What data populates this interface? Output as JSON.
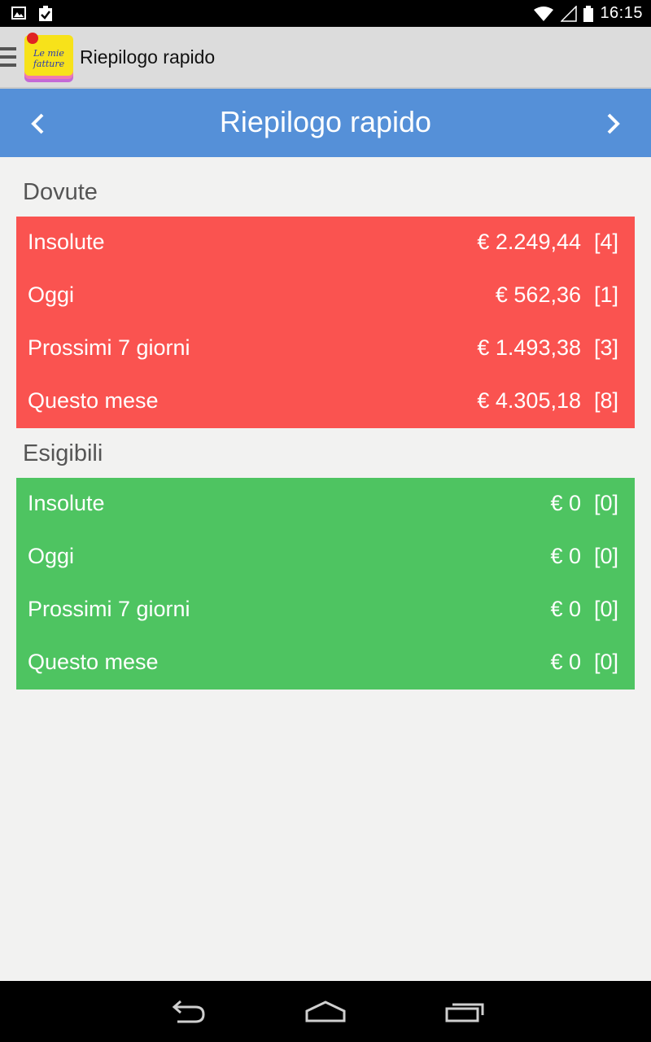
{
  "status_bar": {
    "time": "16:15",
    "icons": [
      "gallery-icon",
      "clipboard-check-icon",
      "wifi-icon",
      "signal-icon",
      "battery-icon"
    ]
  },
  "action_bar": {
    "app_logo_text": "Le mie fatture",
    "title": "Riepilogo rapido"
  },
  "header": {
    "title": "Riepilogo rapido",
    "prev_icon": "chevron-left-icon",
    "next_icon": "chevron-right-icon"
  },
  "sections": [
    {
      "title": "Dovute",
      "color": "#fa5350",
      "rows": [
        {
          "label": "Insolute",
          "amount": "€ 2.249,44",
          "count": "[4]"
        },
        {
          "label": "Oggi",
          "amount": "€ 562,36",
          "count": "[1]"
        },
        {
          "label": "Prossimi 7 giorni",
          "amount": "€ 1.493,38",
          "count": "[3]"
        },
        {
          "label": "Questo mese",
          "amount": "€ 4.305,18",
          "count": "[8]"
        }
      ]
    },
    {
      "title": "Esigibili",
      "color": "#4ec461",
      "rows": [
        {
          "label": "Insolute",
          "amount": "€ 0",
          "count": "[0]"
        },
        {
          "label": "Oggi",
          "amount": "€ 0",
          "count": "[0]"
        },
        {
          "label": "Prossimi 7 giorni",
          "amount": "€ 0",
          "count": "[0]"
        },
        {
          "label": "Questo mese",
          "amount": "€ 0",
          "count": "[0]"
        }
      ]
    }
  ],
  "nav_bar": {
    "icons": [
      "back-icon",
      "home-icon",
      "recents-icon"
    ]
  },
  "colors": {
    "header_blue": "#5590d8",
    "action_bar_gray": "#dcdcdc",
    "background": "#f2f2f1"
  }
}
